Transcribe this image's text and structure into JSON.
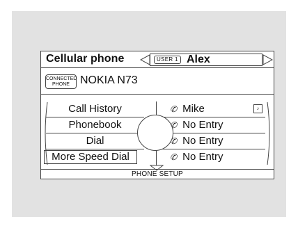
{
  "header": {
    "title": "Cellular phone",
    "user_badge": "USER 1",
    "user_name": "Alex"
  },
  "connection": {
    "badge_line1": "CONNECTED",
    "badge_line2": "PHONE",
    "model": "NOKIA N73"
  },
  "menu": {
    "left_items": [
      {
        "label": "Call History"
      },
      {
        "label": "Phonebook"
      },
      {
        "label": "Dial"
      },
      {
        "label": "More Speed Dial",
        "selected": true
      }
    ],
    "speed_dial": [
      {
        "label": "Mike",
        "has_voice_tag": true
      },
      {
        "label": "No Entry"
      },
      {
        "label": "No Entry"
      },
      {
        "label": "No Entry"
      }
    ]
  },
  "footer": {
    "label": "PHONE SETUP"
  },
  "icons": [
    "arrow-left-icon",
    "arrow-right-icon",
    "phone-icon",
    "voice-tag-icon",
    "down-arrow-icon"
  ]
}
